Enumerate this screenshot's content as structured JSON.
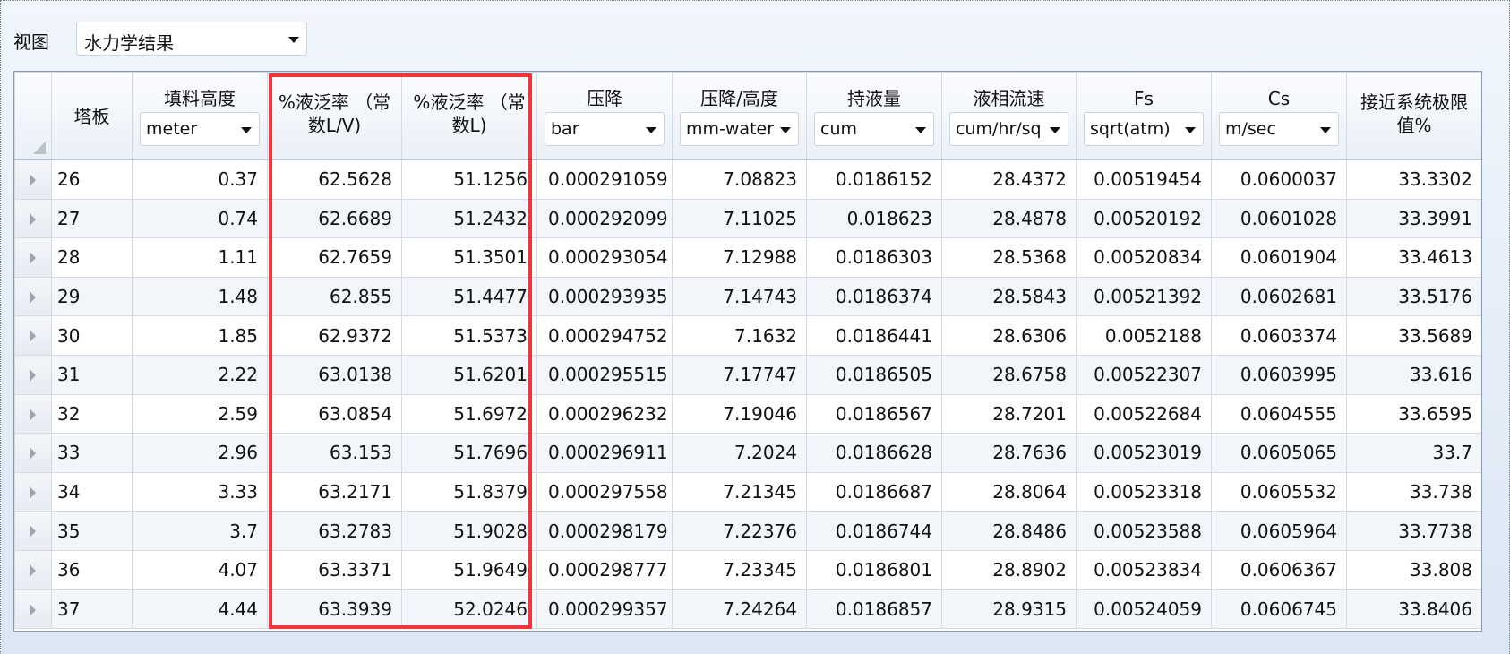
{
  "view": {
    "label": "视图",
    "selected": "水力学结果"
  },
  "columns": [
    {
      "label": "塔板",
      "unit": null
    },
    {
      "label": "填料高度",
      "unit": "meter"
    },
    {
      "label": "%液泛率 （常数L/V)",
      "unit": null
    },
    {
      "label": "%液泛率 （常数L)",
      "unit": null
    },
    {
      "label": "压降",
      "unit": "bar"
    },
    {
      "label": "压降/高度",
      "unit": "mm-water"
    },
    {
      "label": "持液量",
      "unit": "cum"
    },
    {
      "label": "液相流速",
      "unit": "cum/hr/sq"
    },
    {
      "label": "Fs",
      "unit": "sqrt(atm)"
    },
    {
      "label": "Cs",
      "unit": "m/sec"
    },
    {
      "label": "接近系统极限值%",
      "unit": null
    }
  ],
  "rows": [
    [
      "26",
      "0.37",
      "62.5628",
      "51.1256",
      "0.000291059",
      "7.08823",
      "0.0186152",
      "28.4372",
      "0.00519454",
      "0.0600037",
      "33.3302"
    ],
    [
      "27",
      "0.74",
      "62.6689",
      "51.2432",
      "0.000292099",
      "7.11025",
      "0.018623",
      "28.4878",
      "0.00520192",
      "0.0601028",
      "33.3991"
    ],
    [
      "28",
      "1.11",
      "62.7659",
      "51.3501",
      "0.000293054",
      "7.12988",
      "0.0186303",
      "28.5368",
      "0.00520834",
      "0.0601904",
      "33.4613"
    ],
    [
      "29",
      "1.48",
      "62.855",
      "51.4477",
      "0.000293935",
      "7.14743",
      "0.0186374",
      "28.5843",
      "0.00521392",
      "0.0602681",
      "33.5176"
    ],
    [
      "30",
      "1.85",
      "62.9372",
      "51.5373",
      "0.000294752",
      "7.1632",
      "0.0186441",
      "28.6306",
      "0.0052188",
      "0.0603374",
      "33.5689"
    ],
    [
      "31",
      "2.22",
      "63.0138",
      "51.6201",
      "0.000295515",
      "7.17747",
      "0.0186505",
      "28.6758",
      "0.00522307",
      "0.0603995",
      "33.616"
    ],
    [
      "32",
      "2.59",
      "63.0854",
      "51.6972",
      "0.000296232",
      "7.19046",
      "0.0186567",
      "28.7201",
      "0.00522684",
      "0.0604555",
      "33.6595"
    ],
    [
      "33",
      "2.96",
      "63.153",
      "51.7696",
      "0.000296911",
      "7.2024",
      "0.0186628",
      "28.7636",
      "0.00523019",
      "0.0605065",
      "33.7"
    ],
    [
      "34",
      "3.33",
      "63.2171",
      "51.8379",
      "0.000297558",
      "7.21345",
      "0.0186687",
      "28.8064",
      "0.00523318",
      "0.0605532",
      "33.738"
    ],
    [
      "35",
      "3.7",
      "63.2783",
      "51.9028",
      "0.000298179",
      "7.22376",
      "0.0186744",
      "28.8486",
      "0.00523588",
      "0.0605964",
      "33.7738"
    ],
    [
      "36",
      "4.07",
      "63.3371",
      "51.9649",
      "0.000298777",
      "7.23345",
      "0.0186801",
      "28.8902",
      "0.00523834",
      "0.0606367",
      "33.808"
    ],
    [
      "37",
      "4.44",
      "63.3939",
      "52.0246",
      "0.000299357",
      "7.24264",
      "0.0186857",
      "28.9315",
      "0.00524059",
      "0.0606745",
      "33.8406"
    ]
  ],
  "colors": {
    "highlight_border": "#f0363c",
    "alt_row": "#f2f6fb",
    "grid_line": "#d4dbe4"
  }
}
